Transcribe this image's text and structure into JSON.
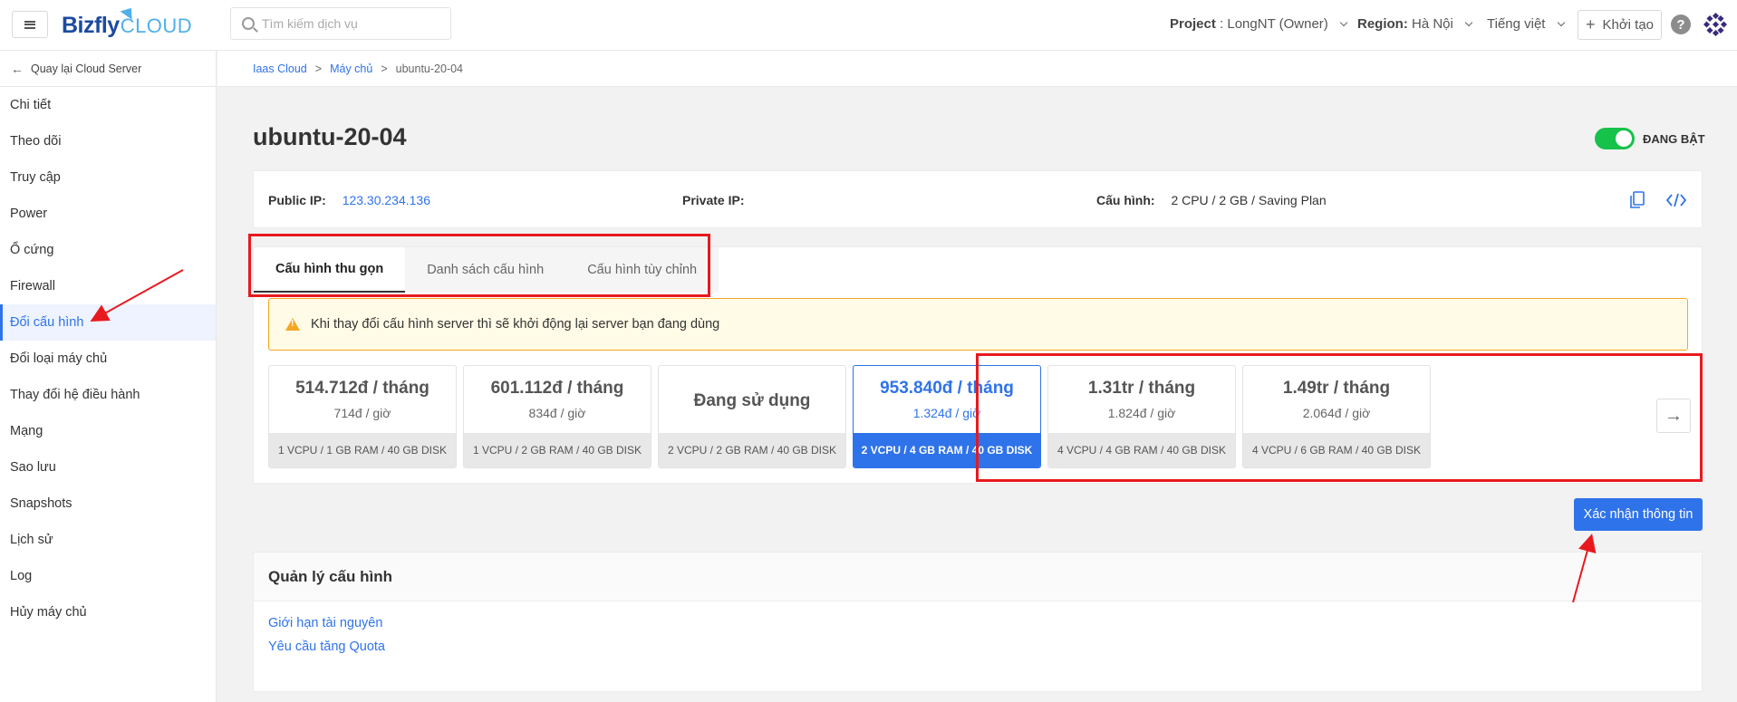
{
  "topbar": {
    "logo_main": "Bizfly",
    "logo_sub": "CLOUD",
    "search_placeholder": "Tìm kiếm dịch vụ",
    "project_label": "Project",
    "project_value": ": LongNT (Owner)",
    "region_label": "Region:",
    "region_value": "Hà Nội",
    "language": "Tiếng việt",
    "create_label": "Khởi tạo",
    "help_glyph": "?"
  },
  "sidebar": {
    "back_label": "Quay lại Cloud Server",
    "items": [
      {
        "label": "Chi tiết"
      },
      {
        "label": "Theo dõi"
      },
      {
        "label": "Truy cập"
      },
      {
        "label": "Power"
      },
      {
        "label": "Ổ cứng"
      },
      {
        "label": "Firewall"
      },
      {
        "label": "Đổi cấu hình",
        "active": true
      },
      {
        "label": "Đổi loại máy chủ"
      },
      {
        "label": "Thay đổi hệ điều hành"
      },
      {
        "label": "Mạng"
      },
      {
        "label": "Sao lưu"
      },
      {
        "label": "Snapshots"
      },
      {
        "label": "Lịch sử"
      },
      {
        "label": "Log"
      },
      {
        "label": "Hủy máy chủ"
      }
    ]
  },
  "breadcrumb": {
    "items": [
      "Iaas Cloud",
      "Máy chủ",
      "ubuntu-20-04"
    ],
    "separator": ">"
  },
  "server": {
    "name": "ubuntu-20-04",
    "status": "ĐANG BẬT",
    "status_color": "#16c24a",
    "public_ip_label": "Public IP:",
    "public_ip": "123.30.234.136",
    "private_ip_label": "Private IP:",
    "private_ip": "",
    "config_label": "Cấu hình:",
    "config_value": "2 CPU / 2 GB / Saving Plan"
  },
  "config": {
    "tabs": [
      {
        "label": "Cấu hình thu gọn",
        "active": true
      },
      {
        "label": "Danh sách cấu hình"
      },
      {
        "label": "Cấu hình tùy chỉnh"
      }
    ],
    "warning": "Khi thay đổi cấu hình server thì sẽ khởi động lại server bạn đang dùng",
    "plans": [
      {
        "price": "514.712đ / tháng",
        "hour": "714đ / giờ",
        "spec": "1 VCPU / 1 GB RAM / 40 GB DISK"
      },
      {
        "price": "601.112đ / tháng",
        "hour": "834đ / giờ",
        "spec": "1 VCPU / 2 GB RAM / 40 GB DISK"
      },
      {
        "inuse": "Đang sử dụng",
        "spec": "2 VCPU / 2 GB RAM / 40 GB DISK"
      },
      {
        "price": "953.840đ / tháng",
        "hour": "1.324đ / giờ",
        "spec": "2 VCPU / 4 GB RAM / 40 GB DISK",
        "selected": true
      },
      {
        "price": "1.31tr / tháng",
        "hour": "1.824đ / giờ",
        "spec": "4 VCPU / 4 GB RAM / 40 GB DISK"
      },
      {
        "price": "1.49tr / tháng",
        "hour": "2.064đ / giờ",
        "spec": "4 VCPU / 6 GB RAM / 40 GB DISK"
      }
    ],
    "confirm_label": "Xác nhận thông tin",
    "accent_color": "#2f73ea"
  },
  "management": {
    "title": "Quản lý cấu hình",
    "links": [
      "Giới hạn tài nguyên",
      "Yêu cầu tăng Quota"
    ]
  },
  "annotation_color": "#e8191e"
}
